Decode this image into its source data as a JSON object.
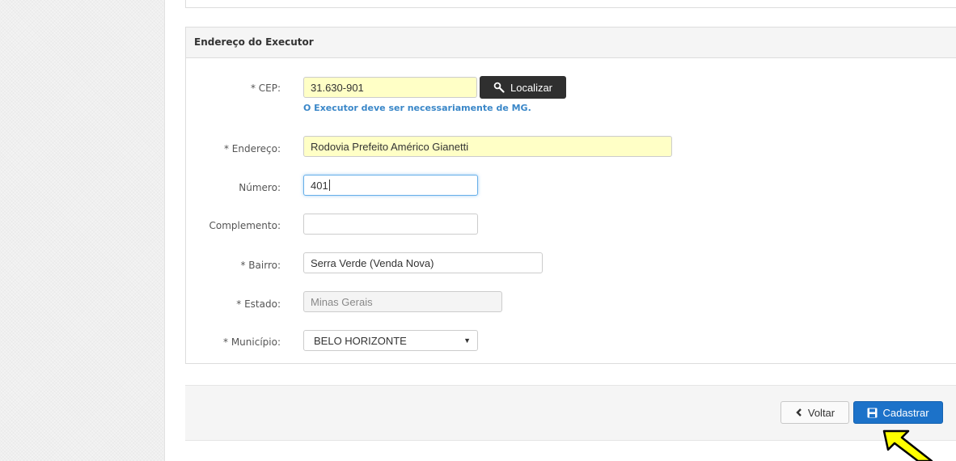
{
  "panel": {
    "title": "Endereço do Executor"
  },
  "form": {
    "cep": {
      "label": "* CEP:",
      "value": "31.630-901"
    },
    "localizar_label": "Localizar",
    "cep_hint": "O Executor deve ser necessariamente de MG.",
    "endereco": {
      "label": "* Endereço:",
      "value": "Rodovia Prefeito Américo Gianetti"
    },
    "numero": {
      "label": "Número:",
      "value": "401"
    },
    "complemento": {
      "label": "Complemento:",
      "value": ""
    },
    "bairro": {
      "label": "* Bairro:",
      "value": "Serra Verde (Venda Nova)"
    },
    "estado": {
      "label": "* Estado:",
      "value": "Minas Gerais"
    },
    "municipio": {
      "label": "* Município:",
      "value": "BELO HORIZONTE"
    }
  },
  "footer": {
    "voltar_label": "Voltar",
    "cadastrar_label": "Cadastrar"
  },
  "icons": {
    "localizar": "search-icon",
    "voltar": "chevron-left-icon",
    "cadastrar": "floppy-disk-icon",
    "select": "caret-down-icon",
    "pointer": "arrow-pointer-icon"
  },
  "colors": {
    "required_field_bg": "#ffffc6",
    "hint_text": "#3a87c8",
    "primary_button": "#1c72c9",
    "dark_button": "#2f2f2f",
    "pointer_arrow": "#ffff00"
  }
}
